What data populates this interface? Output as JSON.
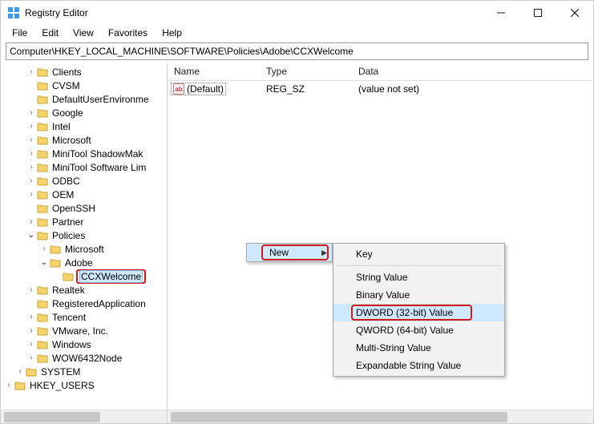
{
  "window": {
    "title": "Registry Editor"
  },
  "menu": {
    "file": "File",
    "edit": "Edit",
    "view": "View",
    "favorites": "Favorites",
    "help": "Help"
  },
  "address": "Computer\\HKEY_LOCAL_MACHINE\\SOFTWARE\\Policies\\Adobe\\CCXWelcome",
  "tree": {
    "clients": "Clients",
    "cvsm": "CVSM",
    "defaultuserenv": "DefaultUserEnvironme",
    "google": "Google",
    "intel": "Intel",
    "microsoft": "Microsoft",
    "minitool_shadow": "MiniTool ShadowMak",
    "minitool_soft": "MiniTool Software Lim",
    "odbc": "ODBC",
    "oem": "OEM",
    "openssh": "OpenSSH",
    "partner": "Partner",
    "policies": "Policies",
    "policies_microsoft": "Microsoft",
    "policies_adobe": "Adobe",
    "policies_ccx": "CCXWelcome",
    "realtek": "Realtek",
    "regapps": "RegisteredApplication",
    "tencent": "Tencent",
    "vmware": "VMware, Inc.",
    "windows": "Windows",
    "wow64": "WOW6432Node",
    "system": "SYSTEM",
    "hkey_users": "HKEY_USERS"
  },
  "columns": {
    "name": "Name",
    "type": "Type",
    "data": "Data"
  },
  "rows": {
    "default": {
      "icon": "ab",
      "name": "(Default)",
      "type": "REG_SZ",
      "data": "(value not set)"
    }
  },
  "context1": {
    "new": "New"
  },
  "context2": {
    "key": "Key",
    "string": "String Value",
    "binary": "Binary Value",
    "dword": "DWORD (32-bit) Value",
    "qword": "QWORD (64-bit) Value",
    "multi": "Multi-String Value",
    "expand": "Expandable String Value"
  }
}
